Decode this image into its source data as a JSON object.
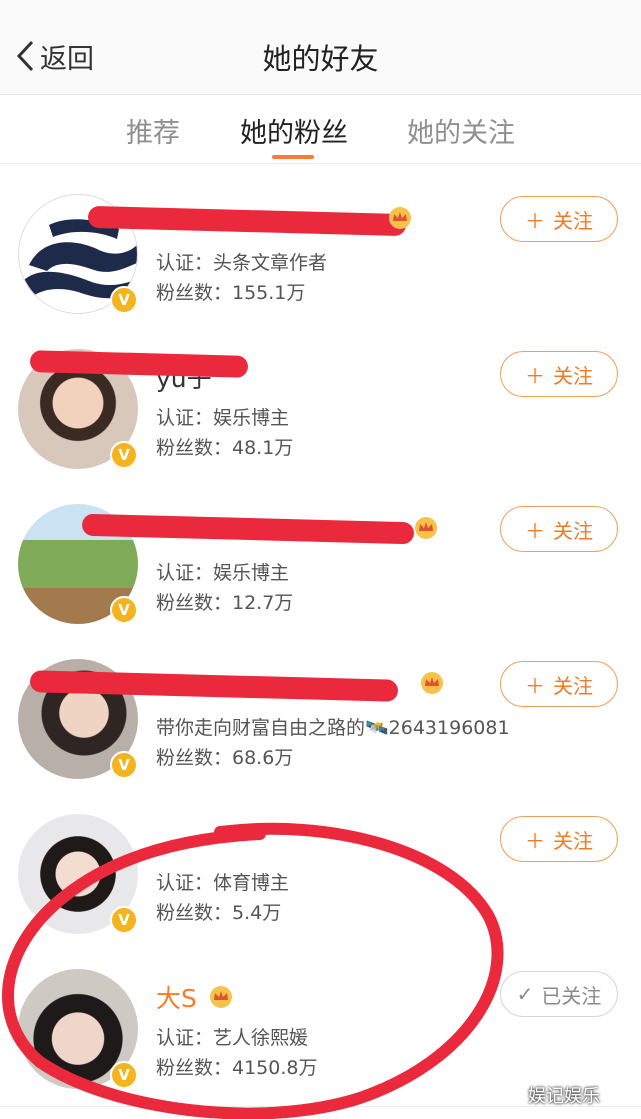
{
  "nav": {
    "back_label": "返回",
    "title": "她的好友"
  },
  "tabs": [
    {
      "label": "推荐",
      "active": false
    },
    {
      "label": "她的粉丝",
      "active": true
    },
    {
      "label": "她的关注",
      "active": false
    }
  ],
  "users": [
    {
      "name": "",
      "line1": "认证：头条文章作者",
      "line2": "粉丝数：155.1万",
      "button": "关注",
      "followed": false
    },
    {
      "name": "yu子",
      "line1": "认证：娱乐博主",
      "line2": "粉丝数：48.1万",
      "button": "关注",
      "followed": false
    },
    {
      "name": "",
      "line1": "认证：娱乐博主",
      "line2": "粉丝数：12.7万",
      "button": "关注",
      "followed": false
    },
    {
      "name": "",
      "line1": "带你走向财富自由之路的🛰️2643196081",
      "line2": "粉丝数：68.6万",
      "button": "关注",
      "followed": false
    },
    {
      "name": "",
      "line1": "认证：体育博主",
      "line2": "粉丝数：5.4万",
      "button": "关注",
      "followed": false
    },
    {
      "name": "大S",
      "line1": "认证：艺人徐熙媛",
      "line2": "粉丝数：4150.8万",
      "button": "已关注",
      "followed": true
    }
  ],
  "badge": "V",
  "watermark": "娱记娱乐",
  "colors": {
    "accent": "#f07b26",
    "verified": "#f5b31e",
    "annotation": "#ea2a3c"
  }
}
